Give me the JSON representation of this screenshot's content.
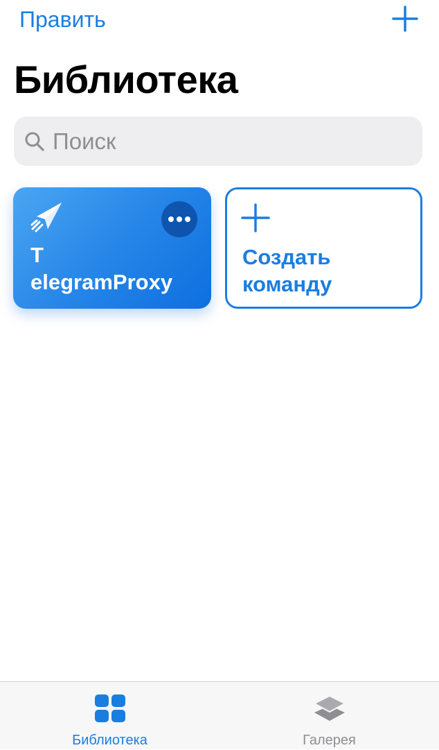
{
  "nav": {
    "edit_label": "Править",
    "add_icon": "plus-icon"
  },
  "page_title": "Библиотека",
  "search": {
    "placeholder": "Поиск",
    "icon": "search-icon"
  },
  "shortcuts": [
    {
      "title": "T\nelegramProxy",
      "icon": "paper-plane-icon",
      "more_icon": "ellipsis-icon",
      "gradient": [
        "#4aa6f2",
        "#0d6fe0"
      ]
    }
  ],
  "create_shortcut": {
    "label": "Создать команду",
    "icon": "plus-icon"
  },
  "tab_bar": {
    "tabs": [
      {
        "label": "Библиотека",
        "icon": "grid-icon",
        "selected": true
      },
      {
        "label": "Галерея",
        "icon": "layers-icon",
        "selected": false
      }
    ]
  },
  "colors": {
    "accent": "#1a7ee0",
    "inactive": "#8e8e93",
    "search_bg": "#eeeef0"
  }
}
